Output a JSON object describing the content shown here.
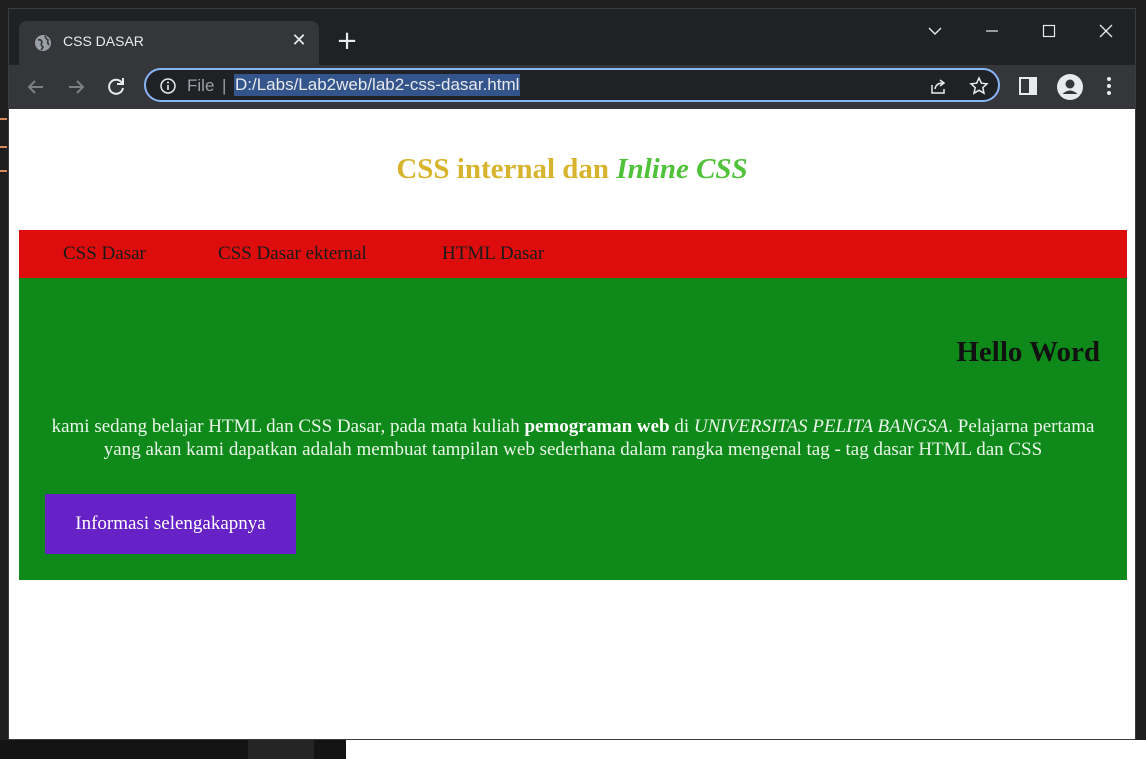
{
  "browser": {
    "tab": {
      "title": "CSS DASAR",
      "close_symbol": "✕"
    },
    "new_tab_symbol": "+",
    "address_bar": {
      "scheme_label": "File",
      "separator": "|",
      "url": "D:/Labs/Lab2web/lab2-css-dasar.html"
    },
    "icons": [
      "globe-icon",
      "back-icon",
      "forward-icon",
      "reload-icon",
      "info-icon",
      "share-icon",
      "star-icon",
      "side-panel-icon",
      "profile-icon",
      "menu-icon",
      "tab-search-icon",
      "minimize-icon",
      "maximize-icon",
      "close-icon"
    ],
    "accent_color": "#8ab4f8"
  },
  "page": {
    "heading": {
      "part1": "CSS internal dan ",
      "part2": "Inline CSS"
    },
    "nav": [
      "CSS Dasar",
      "CSS Dasar ekternal",
      "HTML Dasar"
    ],
    "content": {
      "hello": "Hello Word",
      "para": {
        "t1": "kami sedang belajar HTML dan CSS Dasar, pada mata kuliah ",
        "bold": "pemograman web",
        "t2": " di ",
        "italic": "UNIVERSITAS PELITA BANGSA",
        "t3": ". Pelajarna pertama yang akan kami dapatkan adalah membuat tampilan web sederhana dalam rangka mengenal tag - tag dasar HTML dan CSS"
      },
      "button": "Informasi selengakapnya"
    },
    "colors": {
      "heading": "#d8b32e",
      "heading_em": "#4fc23a",
      "nav_bg": "#dd0d0d",
      "content_bg": "#0f8a1a",
      "button_bg": "#6621c7"
    }
  }
}
